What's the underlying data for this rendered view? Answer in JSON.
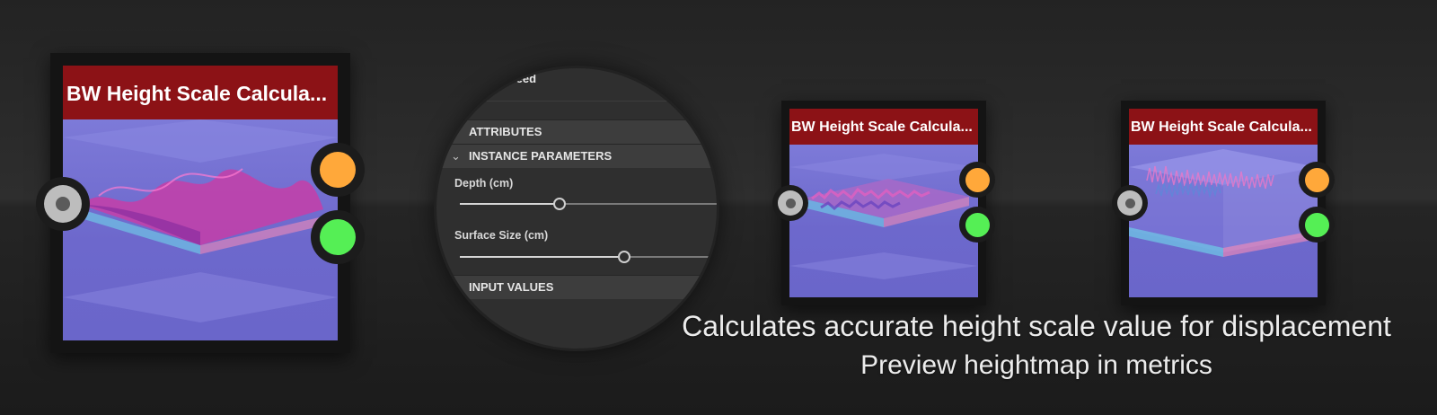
{
  "nodes": [
    {
      "title": "BW Height Scale Calcula...",
      "preview": "wave-heightmap"
    },
    {
      "title": "BW Height Scale Calcula...",
      "preview": "rock-heightmap"
    },
    {
      "title": "BW Height Scale Calcula...",
      "preview": "spike-heightmap"
    }
  ],
  "panel": {
    "seed_label": "Seed",
    "sections": [
      {
        "label": "ATTRIBUTES",
        "expanded": false,
        "icon": "chevron-right-icon"
      },
      {
        "label": "INSTANCE PARAMETERS",
        "expanded": true,
        "icon": "chevron-down-icon"
      },
      {
        "label": "INPUT VALUES",
        "expanded": false
      }
    ],
    "params": [
      {
        "label": "Depth (cm)",
        "level": 0.38
      },
      {
        "label": "Surface Size (cm)",
        "level": 0.67
      }
    ]
  },
  "caption": {
    "line1": "Calculates accurate height scale value for displacement",
    "line2": "Preview heightmap in metrics"
  },
  "colors": {
    "title_bar": "#8c1216",
    "preview_bg": "#6d68cc",
    "input_port": "#bdbdbd",
    "output_port_1": "#ffa83a",
    "output_port_2": "#55ef55",
    "background": "#262626"
  }
}
